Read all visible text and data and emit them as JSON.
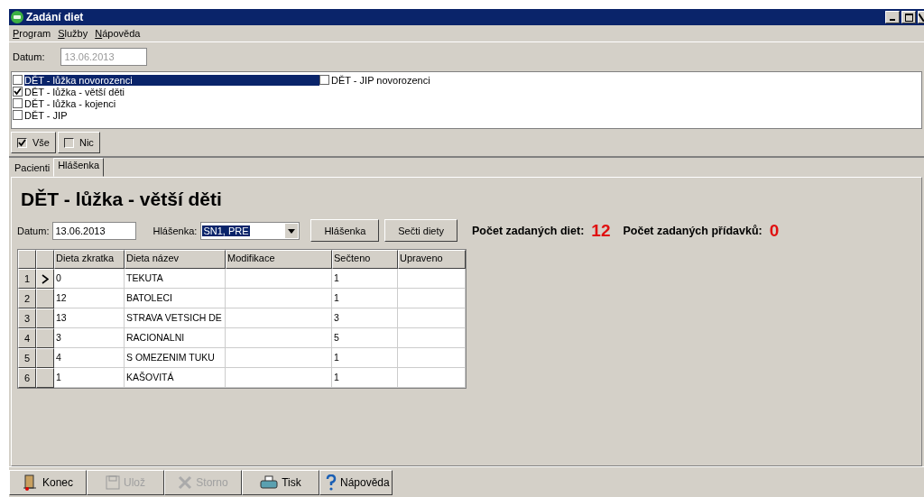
{
  "window": {
    "title": "Zadání diet"
  },
  "menu": [
    {
      "label": "Program"
    },
    {
      "label": "Služby"
    },
    {
      "label": "Nápověda"
    }
  ],
  "date_field": {
    "label": "Datum:",
    "value": "13.06.2013",
    "disabled": true
  },
  "wards": [
    {
      "label": "DĚT - lůžka novorozenci",
      "checked": false,
      "selected": true
    },
    {
      "label": "DĚT - lůžka - větší děti",
      "checked": true,
      "selected": false
    },
    {
      "label": "DĚT - lůžka - kojenci",
      "checked": false,
      "selected": false
    },
    {
      "label": "DĚT - JIP",
      "checked": false,
      "selected": false
    },
    {
      "label": "DĚT - JIP novorozenci",
      "checked": false,
      "selected": false
    }
  ],
  "select_buttons": [
    {
      "label": "Vše",
      "checked": true
    },
    {
      "label": "Nic",
      "checked": false
    }
  ],
  "tabs": [
    {
      "label": "Pacienti",
      "selected": false
    },
    {
      "label": "Hlášenka",
      "selected": true
    }
  ],
  "panel": {
    "heading": "DĚT - lůžka - větší děti",
    "date_label": "Datum:",
    "date_value": "13.06.2013",
    "report_label": "Hlášenka:",
    "report_value": "SN1, PRE",
    "buttons": [
      "Hlášenka",
      "Sečti diety"
    ],
    "counts": [
      {
        "label": "Počet zadaných diet:",
        "value": "12"
      },
      {
        "label": "Počet zadaných přídavků:",
        "value": "0"
      }
    ]
  },
  "table": {
    "columns": [
      "Dieta zkratka",
      "Dieta název",
      "Modifikace",
      "Sečteno",
      "Upraveno"
    ],
    "rows": [
      {
        "number": "1",
        "current": true,
        "cells": [
          "0",
          "TEKUTA",
          "",
          "1",
          ""
        ]
      },
      {
        "number": "2",
        "current": false,
        "cells": [
          "12",
          "BATOLECI",
          "",
          "1",
          ""
        ]
      },
      {
        "number": "3",
        "current": false,
        "cells": [
          "13",
          "STRAVA VETSICH DE",
          "",
          "3",
          ""
        ]
      },
      {
        "number": "4",
        "current": false,
        "cells": [
          "3",
          "RACIONALNI",
          "",
          "5",
          ""
        ]
      },
      {
        "number": "5",
        "current": false,
        "cells": [
          "4",
          "S OMEZENIM TUKU",
          "",
          "1",
          ""
        ]
      },
      {
        "number": "6",
        "current": false,
        "cells": [
          "1",
          "KAŠOVITÁ",
          "",
          "1",
          ""
        ]
      }
    ]
  },
  "footer_buttons": [
    {
      "label": "Konec",
      "kind": "exit",
      "disabled": false
    },
    {
      "label": "Ulož",
      "kind": "save",
      "disabled": true
    },
    {
      "label": "Storno",
      "kind": "cancel",
      "disabled": true
    },
    {
      "label": "Tisk",
      "kind": "print",
      "disabled": false
    },
    {
      "label": "Nápověda",
      "kind": "help",
      "disabled": false
    }
  ]
}
